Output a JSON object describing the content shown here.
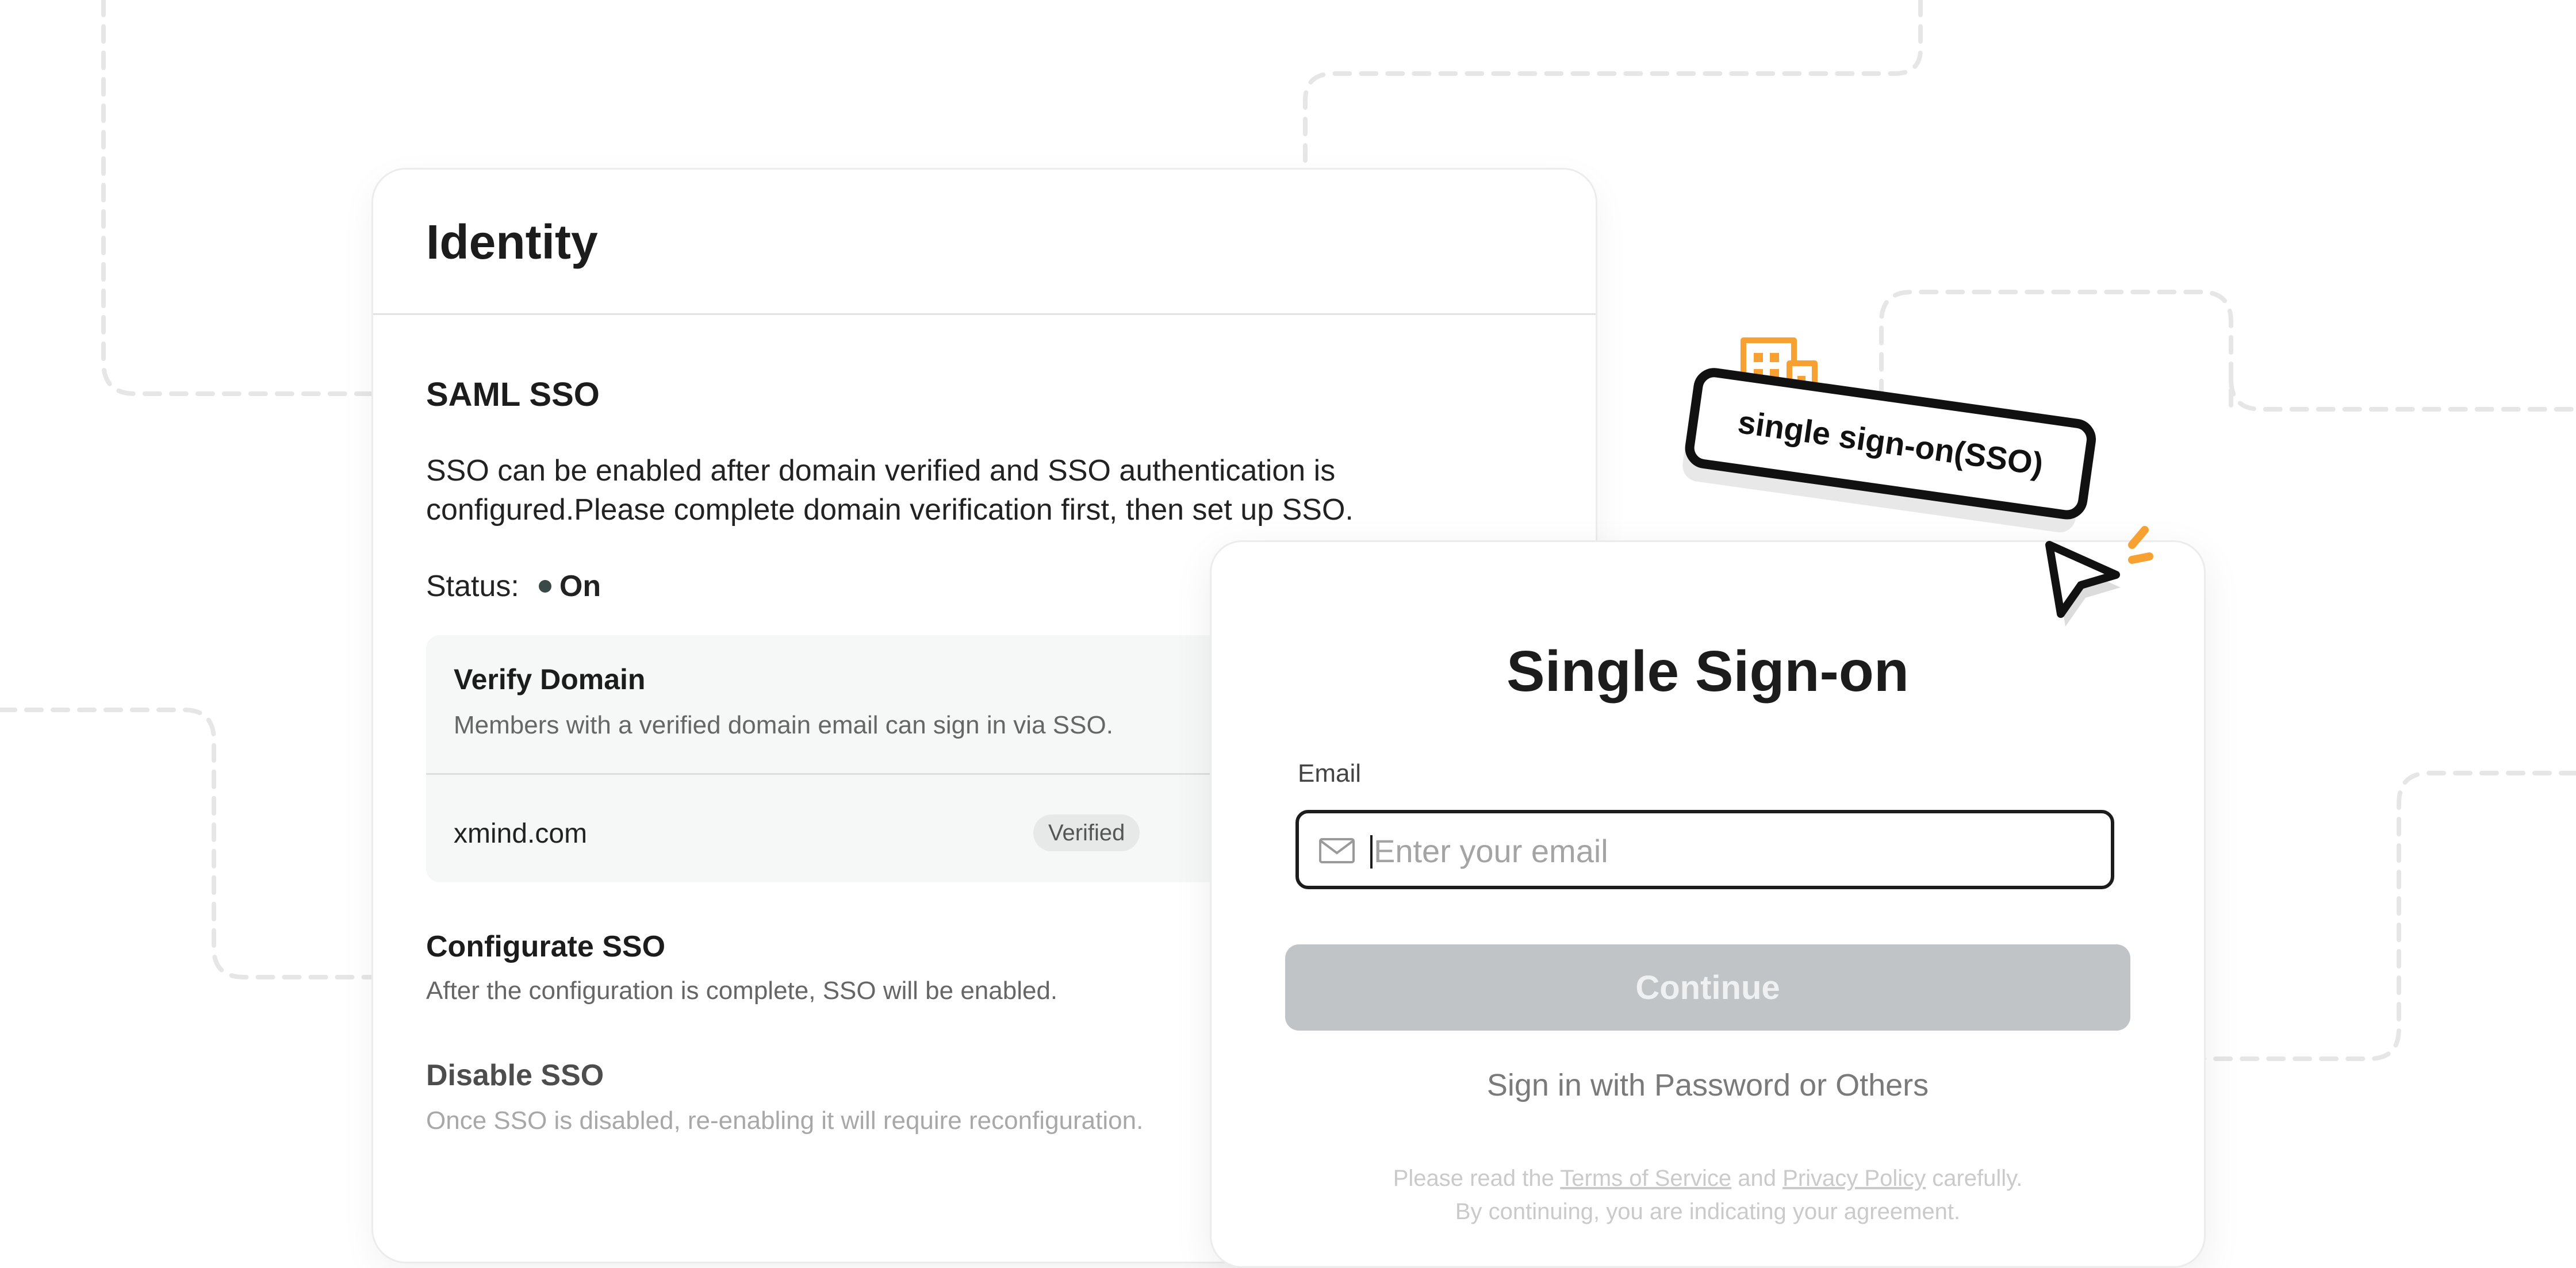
{
  "identity": {
    "title": "Identity",
    "saml_title": "SAML SSO",
    "saml_desc_line1": "SSO can be enabled after domain verified and SSO authentication is",
    "saml_desc_line2": "configured.Please complete domain verification first, then set up SSO.",
    "status_label": "Status:",
    "status_value": "On",
    "verify": {
      "title": "Verify Domain",
      "desc": "Members with a verified domain email can sign in via SSO.",
      "domain": "xmind.com",
      "badge": "Verified"
    },
    "configurate": {
      "title": "Configurate SSO",
      "desc": "After the configuration is complete, SSO will be enabled."
    },
    "disable": {
      "title": "Disable SSO",
      "desc": "Once SSO is disabled, re-enabling it will require reconfiguration."
    }
  },
  "signin": {
    "title": "Single Sign-on",
    "email_label": "Email",
    "email_placeholder": "Enter your email",
    "email_value": "",
    "continue_label": "Continue",
    "alt_label": "Sign in with Password or Others",
    "terms_prefix": "Please read the",
    "terms_link": "Terms of Service",
    "terms_and": "and",
    "privacy_link": "Privacy Policy",
    "terms_suffix": "carefully.",
    "terms_line2": "By continuing, you are indicating your agreement."
  },
  "sticker": {
    "text": "single sign-on(SSO)"
  },
  "icons": {
    "building": "building-icon",
    "cursor": "cursor-icon",
    "mail": "mail-icon"
  },
  "colors": {
    "accent_orange": "#f7a132",
    "status_dot": "#3b4a48",
    "button_disabled": "#c0c4c7",
    "text_dark": "#1c1c1c"
  }
}
